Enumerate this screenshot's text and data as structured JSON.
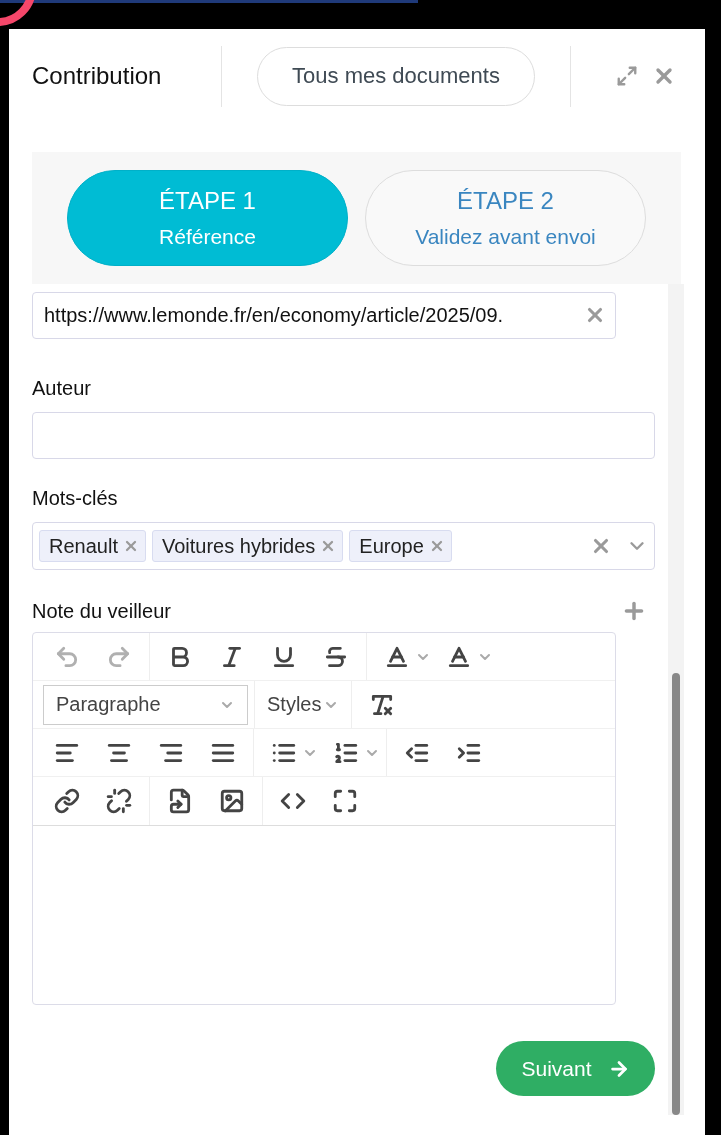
{
  "header": {
    "title": "Contribution",
    "documents_button": "Tous mes documents"
  },
  "steps": [
    {
      "step": "ÉTAPE 1",
      "subtitle": "Référence",
      "selected": true
    },
    {
      "step": "ÉTAPE 2",
      "subtitle": "Validez avant envoi",
      "selected": false
    }
  ],
  "url_field": {
    "value": "https://www.lemonde.fr/en/economy/article/2025/09."
  },
  "author": {
    "label": "Auteur"
  },
  "keywords": {
    "label": "Mots-clés",
    "tags": [
      "Renault",
      "Voitures hybrides",
      "Europe"
    ]
  },
  "note": {
    "label": "Note du veilleur",
    "format_select": "Paragraphe",
    "styles_menu": "Styles",
    "undo_disabled": true,
    "redo_disabled": true
  },
  "next_button": "Suivant"
}
